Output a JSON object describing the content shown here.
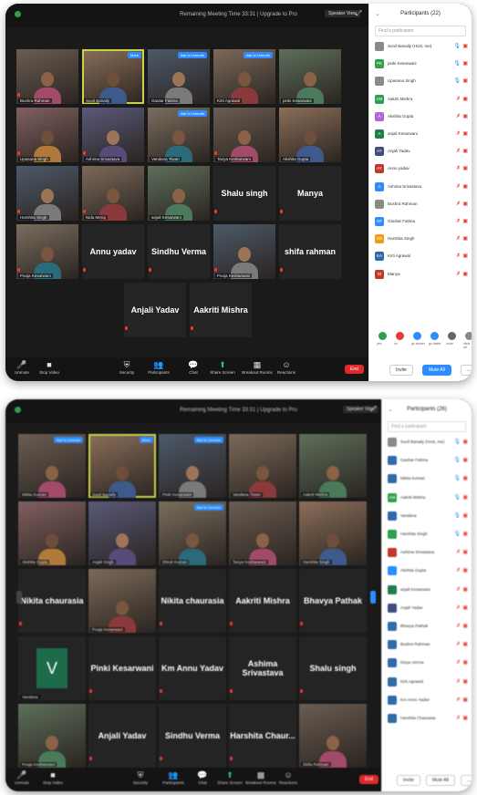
{
  "screens": [
    {
      "meeting_title": "Remaining Meeting Time 33:31 | Upgrade to Pro",
      "speaker_view_label": "Speaker View",
      "tiles": [
        {
          "name": "Bushra Rahman",
          "video": true,
          "muted": true
        },
        {
          "name": "Sunil Banaily",
          "video": true,
          "active": true,
          "badge": "More"
        },
        {
          "name": "Gautar Fatima",
          "video": true,
          "badge": "Ask to Unmute"
        },
        {
          "name": "Kirti Agrawal",
          "video": true,
          "badge": "Ask to Unmute"
        },
        {
          "name": "pinki Kesarwani",
          "video": true
        },
        {
          "name": "Upasana Singh",
          "video": true,
          "muted": true
        },
        {
          "name": "Ashima Srivastava",
          "video": true,
          "muted": true
        },
        {
          "name": "Vandana Tiwari",
          "video": true,
          "badge": "Ask to Unmute"
        },
        {
          "name": "Tanya Kesharwani",
          "video": true,
          "muted": true
        },
        {
          "name": "Akshita Gupta",
          "video": true
        },
        {
          "name": "Harshita Singh",
          "video": true,
          "muted": true
        },
        {
          "name": "Nida Meraj",
          "video": true,
          "muted": true
        },
        {
          "name": "anjali Kesarwani",
          "video": true
        },
        {
          "name": "Shalu singh",
          "big": "Shalu singh"
        },
        {
          "name": "Manya",
          "big": "Manya"
        },
        {
          "name": "Pooja Kesarwani",
          "video": true,
          "muted": true
        },
        {
          "name": "Annu yadav",
          "big": "Annu yadav"
        },
        {
          "name": "Sindhu Verma",
          "big": "Sindhu Verma"
        },
        {
          "name": "Pooja Kesharwani",
          "video": true,
          "muted": true
        },
        {
          "name": "shifa rahman",
          "big": "shifa rahman"
        },
        {
          "name": "Anjali Yadav",
          "big": "Anjali Yadav"
        },
        {
          "name": "Aakriti Mishra",
          "big": "Aakriti Mishra"
        }
      ],
      "toolbar": [
        "Unmute",
        "Stop Video",
        "Security",
        "Participants",
        "Chat",
        "Share Screen",
        "Breakout Rooms",
        "Reactions"
      ],
      "participant_count": "22",
      "end_label": "End",
      "panel": {
        "title": "Participants (22)",
        "search_placeholder": "Find a participant",
        "participants": [
          {
            "initials": "",
            "name": "Sunil Banaily (Host, me)",
            "color": "#8a8a8a",
            "mic_on": true
          },
          {
            "initials": "PK",
            "name": "pinki Kesarwani",
            "color": "#2ea04f",
            "mic_on": true
          },
          {
            "initials": "",
            "name": "Upasana Singh",
            "color": "#8a8a8a",
            "mic_on": true
          },
          {
            "initials": "AM",
            "name": "Aakriti Mishra",
            "color": "#2ea04f",
            "mic_on": false
          },
          {
            "initials": "A",
            "name": "Akshita Gupta",
            "color": "#b565d8",
            "mic_on": false
          },
          {
            "initials": "A",
            "name": "anjali Kesarwani",
            "color": "#1d7f4a",
            "mic_on": false
          },
          {
            "initials": "AY",
            "name": "Anjali Yadav",
            "color": "#3d4f7a",
            "mic_on": false
          },
          {
            "initials": "AY",
            "name": "Annu yadav",
            "color": "#c0392b",
            "mic_on": false
          },
          {
            "initials": "A",
            "name": "Ashima Srivastava",
            "color": "#2d8cff",
            "mic_on": false
          },
          {
            "initials": "",
            "name": "Bushra Rahman",
            "color": "#8a8a8a",
            "mic_on": false
          },
          {
            "initials": "GF",
            "name": "Gauhar Fatima",
            "color": "#2d8cff",
            "mic_on": false
          },
          {
            "initials": "HS",
            "name": "Harshita Singh",
            "color": "#f39c12",
            "mic_on": false
          },
          {
            "initials": "KA",
            "name": "Kirti Agrawal",
            "color": "#2d6ca8",
            "mic_on": false
          },
          {
            "initials": "M",
            "name": "Manya",
            "color": "#c0392b",
            "mic_on": false
          }
        ],
        "reactions": [
          "yes",
          "no",
          "go slower",
          "go faster",
          "more",
          "clear all"
        ],
        "invite_label": "Invite",
        "mute_all_label": "Mute All",
        "more_label": "..."
      }
    },
    {
      "meeting_title": "Remaining Meeting Time 33:31 | Upgrade to Pro",
      "speaker_view_label": "Speaker View",
      "tiles": [
        {
          "name": "Nikita Kumari",
          "video": true,
          "badge": "Ask to Unmute"
        },
        {
          "name": "Sunil Banaily",
          "video": true,
          "active": true,
          "badge": "More"
        },
        {
          "name": "Pinki Kesarwani",
          "video": true,
          "badge": "Ask to Unmute"
        },
        {
          "name": "Vandana Tiwari",
          "video": true
        },
        {
          "name": "Aakriti Mishra",
          "video": true
        },
        {
          "name": "Akshita Gupta",
          "video": true
        },
        {
          "name": "Anjali Singh",
          "video": true
        },
        {
          "name": "Shruti Kumari",
          "video": true,
          "badge": "Ask to Unmute"
        },
        {
          "name": "Tanya Kesharwani",
          "video": true
        },
        {
          "name": "Harshita Singh",
          "video": true
        },
        {
          "name": "Nikita chaurasia",
          "big": "Nikita chaurasia"
        },
        {
          "name": "Pooja Kesarwani",
          "video": true
        },
        {
          "name": "Nikita chaurasia",
          "big": "Nikita chaurasia"
        },
        {
          "name": "Aakriti Mishra",
          "big": "Aakriti Mishra"
        },
        {
          "name": "Bhavya Pathak",
          "big": "Bhavya Pathak"
        },
        {
          "name": "Vandana",
          "letter": "V"
        },
        {
          "name": "Pinki Kesarwani",
          "big": "Pinki Kesarwani"
        },
        {
          "name": "Km Annu Yadav",
          "big": "Km Annu Yadav"
        },
        {
          "name": "Ashima Srivastava",
          "big": "Ashima Srivastava"
        },
        {
          "name": "Shalu singh",
          "big": "Shalu singh"
        },
        {
          "name": "Pooja Kesharwani",
          "video": true
        },
        {
          "name": "Anjali Yadav",
          "big": "Anjali Yadav"
        },
        {
          "name": "Sindhu Verma",
          "big": "Sindhu Verma"
        },
        {
          "name": "Harshita Chaur...",
          "big": "Harshita Chaur..."
        },
        {
          "name": "Shifa Rahman",
          "video": true
        }
      ],
      "toolbar": [
        "Unmute",
        "Stop Video",
        "Security",
        "Participants",
        "Chat",
        "Share Screen",
        "Breakout Rooms",
        "Reactions"
      ],
      "participant_count": "26",
      "end_label": "End",
      "panel": {
        "title": "Participants (26)",
        "search_placeholder": "Find a participant",
        "participants": [
          {
            "initials": "",
            "name": "Sunil Banaily (Host, me)",
            "color": "#8a8a8a",
            "mic_on": true
          },
          {
            "initials": "",
            "name": "Gauhar Fatima",
            "color": "#2d6ca8",
            "mic_on": true
          },
          {
            "initials": "",
            "name": "Nikita Kumari",
            "color": "#2d6ca8",
            "mic_on": true
          },
          {
            "initials": "AM",
            "name": "Aakriti Mishra",
            "color": "#2ea04f",
            "mic_on": true
          },
          {
            "initials": "",
            "name": "Vandana",
            "color": "#2d6ca8",
            "mic_on": true
          },
          {
            "initials": "",
            "name": "Harshita Singh",
            "color": "#2ea04f",
            "mic_on": true
          },
          {
            "initials": "",
            "name": "Ashima Srivastava",
            "color": "#c0392b",
            "mic_on": false
          },
          {
            "initials": "",
            "name": "Akshita Gupta",
            "color": "#2d8cff",
            "mic_on": false
          },
          {
            "initials": "",
            "name": "anjali Kesarwani",
            "color": "#1d7f4a",
            "mic_on": false
          },
          {
            "initials": "",
            "name": "Anjali Yadav",
            "color": "#3d4f7a",
            "mic_on": false
          },
          {
            "initials": "",
            "name": "Bhavya Pathak",
            "color": "#2d6ca8",
            "mic_on": false
          },
          {
            "initials": "",
            "name": "Bushra Rahman",
            "color": "#2d6ca8",
            "mic_on": false
          },
          {
            "initials": "",
            "name": "Divya Verma",
            "color": "#2d6ca8",
            "mic_on": false
          },
          {
            "initials": "",
            "name": "Kirti Agrawal",
            "color": "#2d6ca8",
            "mic_on": false
          },
          {
            "initials": "",
            "name": "Km Annu Yadav",
            "color": "#2d6ca8",
            "mic_on": false
          },
          {
            "initials": "",
            "name": "Harshita Chaurasia",
            "color": "#2d6ca8",
            "mic_on": false
          }
        ],
        "invite_label": "Invite",
        "mute_all_label": "Mute All",
        "more_label": "..."
      }
    }
  ]
}
